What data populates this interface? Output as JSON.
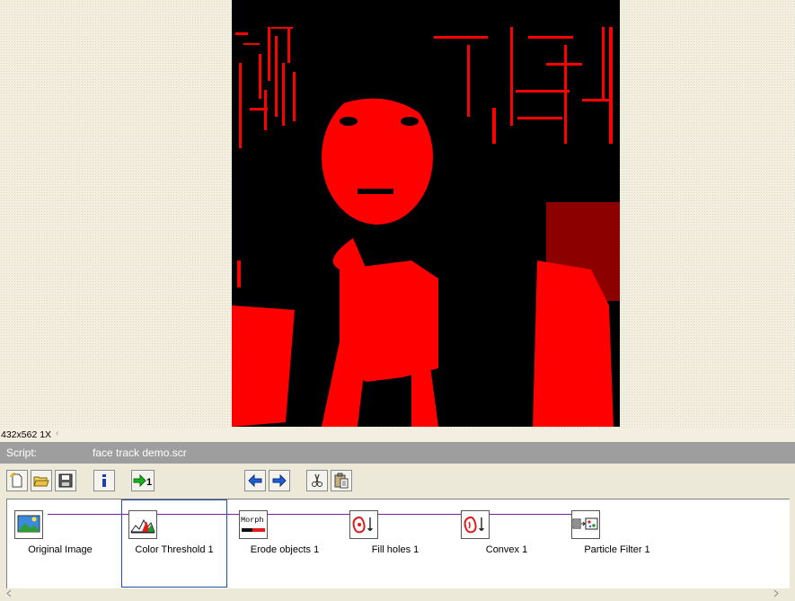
{
  "viewer": {
    "status_text": "432x562 1X",
    "scroll_arrow": "‹"
  },
  "script": {
    "label": "Script:",
    "filename": "face track demo.scr"
  },
  "toolbar": {
    "buttons": [
      {
        "name": "new-script-button",
        "icon": "new-file-icon"
      },
      {
        "name": "open-script-button",
        "icon": "folder-open-icon"
      },
      {
        "name": "save-script-button",
        "icon": "floppy-disk-icon"
      },
      {
        "name": "info-button",
        "icon": "info-icon"
      },
      {
        "name": "run-once-button",
        "icon": "run-once-icon",
        "label": "1"
      },
      {
        "name": "step-back-button",
        "icon": "arrow-left-icon"
      },
      {
        "name": "step-forward-button",
        "icon": "arrow-right-icon"
      },
      {
        "name": "cut-button",
        "icon": "scissors-icon"
      },
      {
        "name": "paste-button",
        "icon": "paste-icon"
      }
    ]
  },
  "steps": [
    {
      "label": "Original Image",
      "icon": "landscape-image-icon"
    },
    {
      "label": "Color Threshold 1",
      "icon": "histogram-icon",
      "selected": true
    },
    {
      "label": "Erode objects 1",
      "icon": "morph-icon",
      "icon_text": "Morph"
    },
    {
      "label": "Fill holes 1",
      "icon": "fill-holes-icon"
    },
    {
      "label": "Convex 1",
      "icon": "convex-hull-icon"
    },
    {
      "label": "Particle Filter 1",
      "icon": "particle-filter-icon"
    }
  ],
  "colors": {
    "threshold_red": "#ff0000",
    "background_black": "#000000",
    "header_gray": "#9e9e9e",
    "connector_purple": "#7b1fa2",
    "selection_blue": "#1f4fa8"
  }
}
